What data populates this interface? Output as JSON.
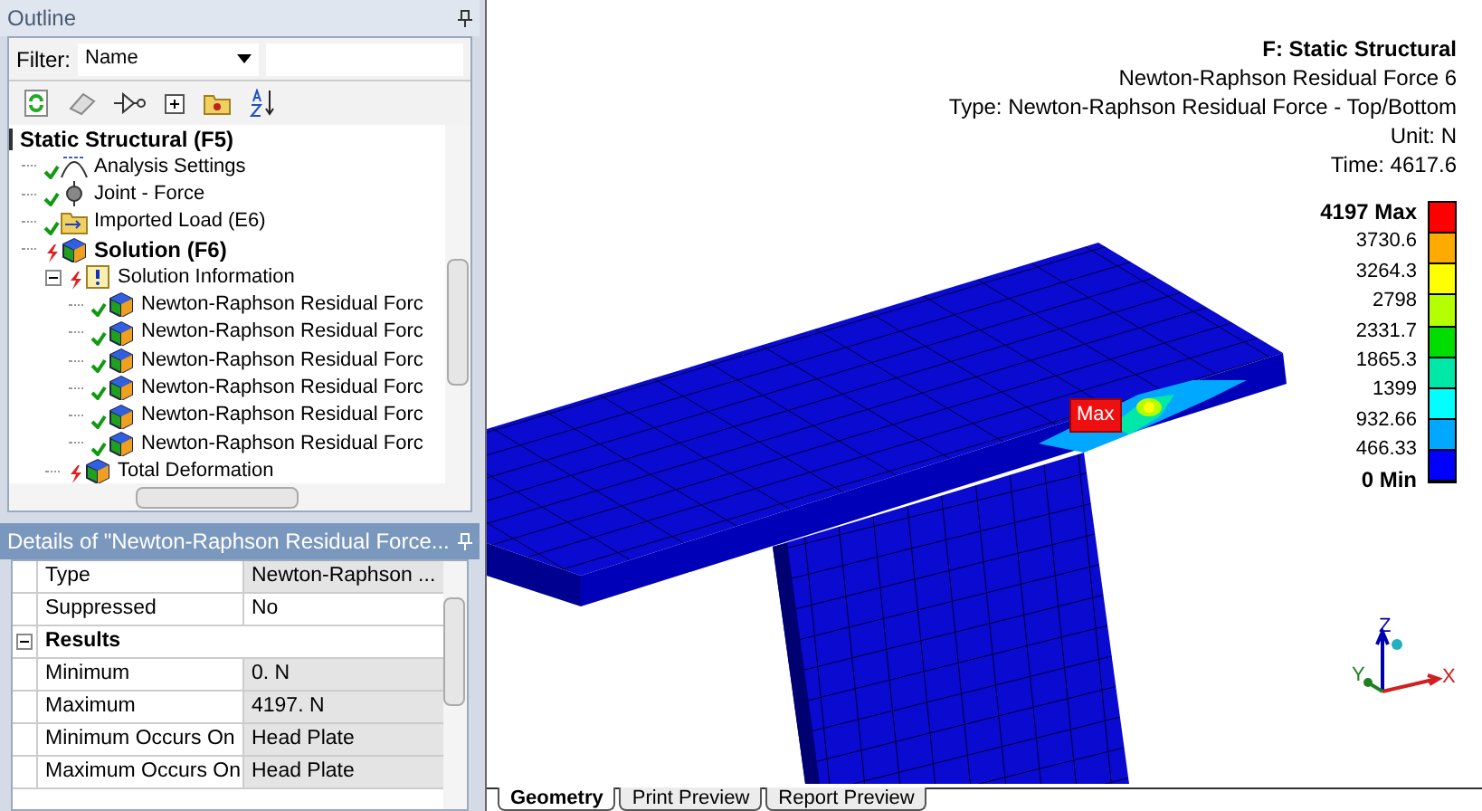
{
  "outline": {
    "title": "Outline",
    "filter_label": "Filter:",
    "filter_value": "Name",
    "tree": [
      {
        "label": "Static Structural (F5)",
        "bold": true,
        "kind": "analysis",
        "children": [
          {
            "label": "Analysis Settings",
            "bold": false,
            "kind": "settings",
            "solved": true
          },
          {
            "label": "Joint - Force",
            "bold": false,
            "kind": "joint",
            "solved": true
          },
          {
            "label": "Imported Load (E6)",
            "bold": false,
            "kind": "import",
            "solved": true
          },
          {
            "label": "Solution (F6)",
            "bold": true,
            "kind": "result",
            "solved": false,
            "children": [
              {
                "label": "Solution Information",
                "bold": false,
                "kind": "info",
                "solved": false,
                "expanded": true,
                "children": [
                  {
                    "label": "Newton-Raphson Residual Forc",
                    "bold": false,
                    "kind": "result",
                    "solved": true
                  },
                  {
                    "label": "Newton-Raphson Residual Forc",
                    "bold": false,
                    "kind": "result",
                    "solved": true
                  },
                  {
                    "label": "Newton-Raphson Residual Forc",
                    "bold": false,
                    "kind": "result",
                    "solved": true
                  },
                  {
                    "label": "Newton-Raphson Residual Forc",
                    "bold": false,
                    "kind": "result",
                    "solved": true
                  },
                  {
                    "label": "Newton-Raphson Residual Forc",
                    "bold": false,
                    "kind": "result",
                    "solved": true
                  },
                  {
                    "label": "Newton-Raphson Residual Forc",
                    "bold": false,
                    "kind": "result",
                    "solved": true
                  }
                ]
              },
              {
                "label": "Total Deformation",
                "bold": false,
                "kind": "result",
                "solved": false
              }
            ]
          }
        ]
      }
    ]
  },
  "details": {
    "title": "Details of \"Newton-Raphson Residual Force...",
    "rows": [
      {
        "kind": "property",
        "name": "Type",
        "value": "Newton-Raphson ...",
        "readonly": true
      },
      {
        "kind": "property",
        "name": "Suppressed",
        "value": "No",
        "readonly": false
      },
      {
        "kind": "group",
        "name": "Results"
      },
      {
        "kind": "property",
        "name": "Minimum",
        "value": "0. N",
        "readonly": true
      },
      {
        "kind": "property",
        "name": "Maximum",
        "value": "4197. N",
        "readonly": true
      },
      {
        "kind": "property",
        "name": "Minimum Occurs On",
        "value": "Head Plate",
        "readonly": true
      },
      {
        "kind": "property",
        "name": "Maximum Occurs On",
        "value": "Head Plate",
        "readonly": true
      }
    ]
  },
  "viewport": {
    "header": [
      "F: Static Structural",
      "Newton-Raphson Residual Force 6",
      "Type: Newton-Raphson Residual Force - Top/Bottom",
      "Unit: N",
      "Time: 4617.6"
    ],
    "legend": {
      "labels": [
        "4197 Max",
        "3730.6",
        "3264.3",
        "2798",
        "2331.7",
        "1865.3",
        "1399",
        "932.66",
        "466.33",
        "0 Min"
      ],
      "bands": [
        {
          "color": "#ff0000"
        },
        {
          "color": "#ffaa00"
        },
        {
          "color": "#ffff00"
        },
        {
          "color": "#b4ff00"
        },
        {
          "color": "#00dd00"
        },
        {
          "color": "#00e8a8"
        },
        {
          "color": "#00ffff"
        },
        {
          "color": "#00a8ff"
        },
        {
          "color": "#0000ff"
        }
      ]
    },
    "max_label": "Max",
    "triad": {
      "x": "X",
      "y": "Y",
      "z": "Z"
    },
    "tabs": [
      {
        "label": "Geometry",
        "selected": true
      },
      {
        "label": "Print Preview",
        "selected": false
      },
      {
        "label": "Report Preview",
        "selected": false
      }
    ]
  }
}
